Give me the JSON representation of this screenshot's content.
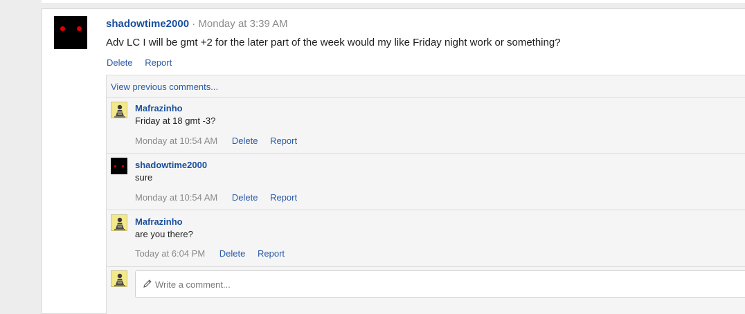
{
  "post": {
    "author": "shadowtime2000",
    "separator": "·",
    "time": "Monday at 3:39 AM",
    "body": "Adv LC I will be gmt +2 for the later part of the week would my like Friday night work or something?",
    "actions": {
      "delete": "Delete",
      "report": "Report"
    }
  },
  "comments_section": {
    "view_previous": "View previous comments...",
    "items": [
      {
        "author": "Mafrazinho",
        "text": "Friday at 18 gmt -3?",
        "time": "Monday at 10:54 AM",
        "delete": "Delete",
        "report": "Report"
      },
      {
        "author": "shadowtime2000",
        "text": "sure",
        "time": "Monday at 10:54 AM",
        "delete": "Delete",
        "report": "Report"
      },
      {
        "author": "Mafrazinho",
        "text": "are you there?",
        "time": "Today at 6:04 PM",
        "delete": "Delete",
        "report": "Report"
      }
    ],
    "write_placeholder": "Write a comment..."
  },
  "colors": {
    "link": "#2a5aa8",
    "username": "#1a4f9c",
    "muted": "#8a8a8a"
  }
}
